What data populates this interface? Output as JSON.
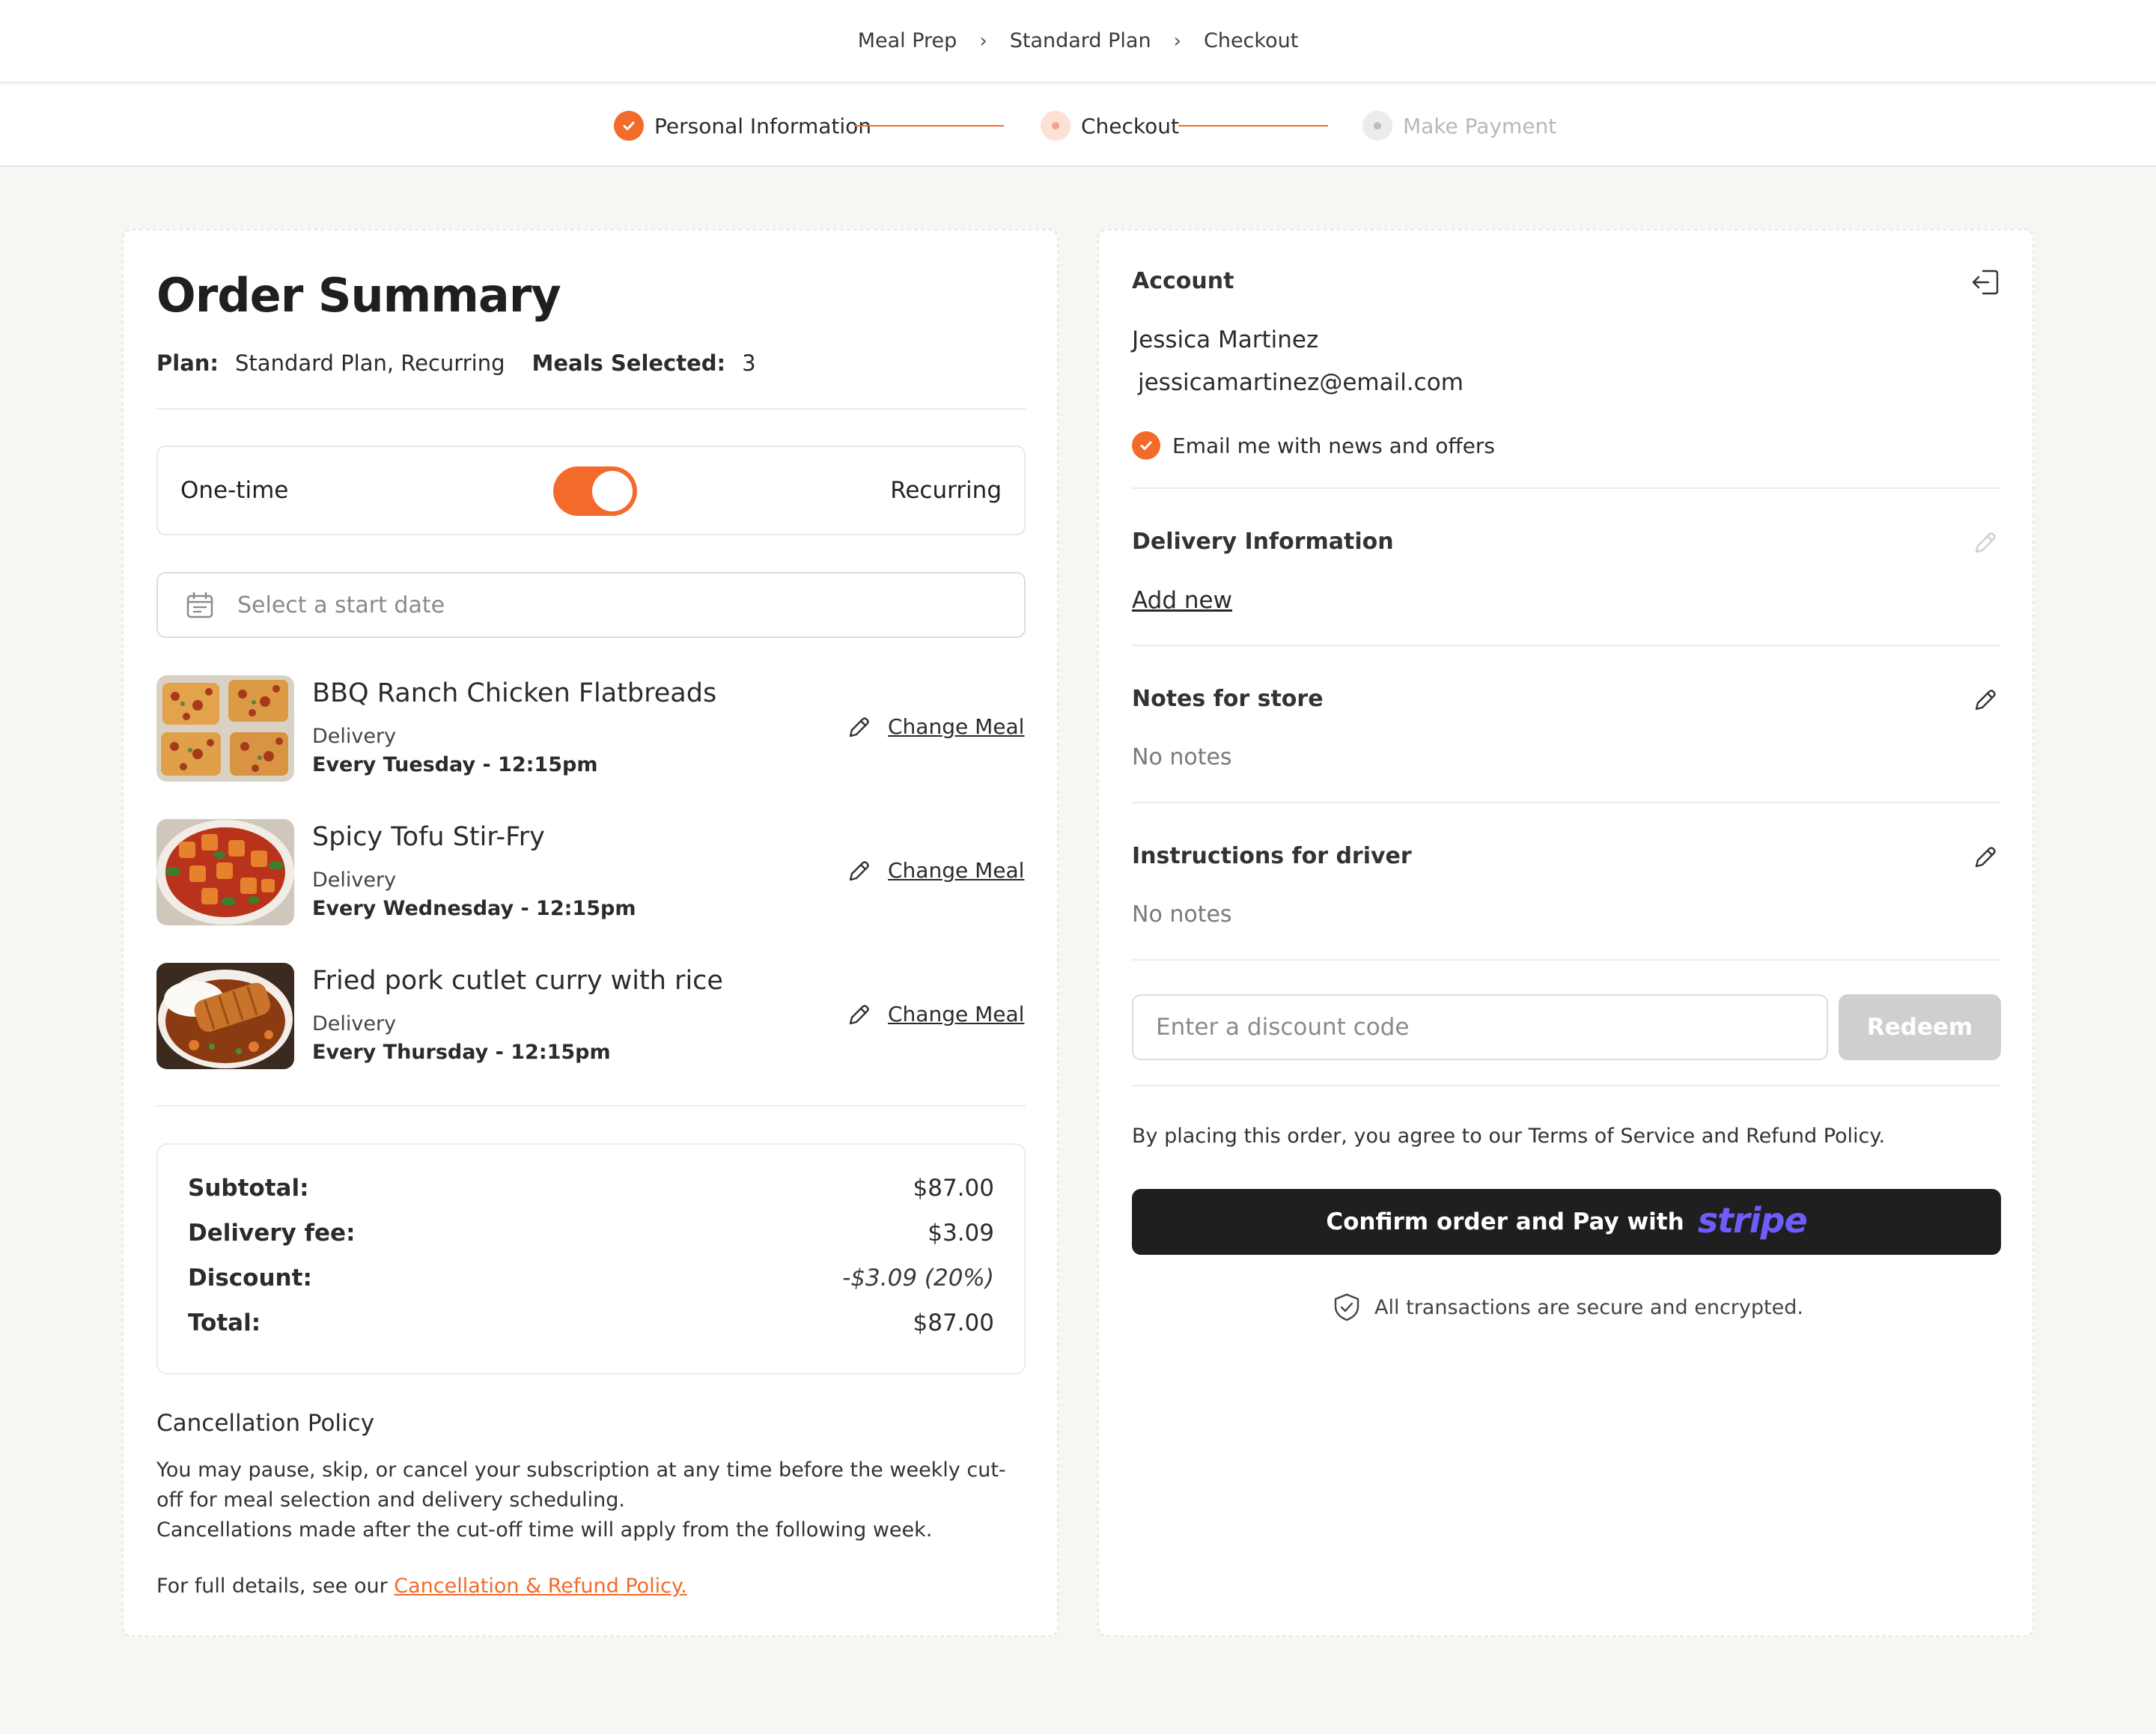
{
  "breadcrumb": [
    "Meal Prep",
    "Standard Plan",
    "Checkout"
  ],
  "breadcrumb_sep": "›",
  "steps": [
    {
      "label": "Personal Information",
      "state": "done"
    },
    {
      "label": "Checkout",
      "state": "active"
    },
    {
      "label": "Make Payment",
      "state": "pending"
    }
  ],
  "order": {
    "title": "Order Summary",
    "plan_label": "Plan:",
    "plan_value": "Standard Plan, Recurring",
    "meals_label": "Meals Selected:",
    "meals_value": "3",
    "toggle_left": "One-time",
    "toggle_right": "Recurring",
    "toggle_on": true,
    "date_placeholder": "Select a start date",
    "meals": [
      {
        "name": "BBQ Ranch Chicken Flatbreads",
        "type": "Delivery",
        "when": "Every Tuesday - 12:15pm",
        "action": "Change Meal"
      },
      {
        "name": "Spicy Tofu Stir-Fry",
        "type": "Delivery",
        "when": "Every Wednesday - 12:15pm",
        "action": "Change Meal"
      },
      {
        "name": "Fried pork cutlet curry with rice",
        "type": "Delivery",
        "when": "Every Thursday - 12:15pm",
        "action": "Change Meal"
      }
    ],
    "totals": {
      "subtotal_label": "Subtotal:",
      "subtotal": "$87.00",
      "delivery_label": "Delivery fee:",
      "delivery": "$3.09",
      "discount_label": "Discount:",
      "discount": "-$3.09 (20%)",
      "total_label": "Total:",
      "total": "$87.00"
    },
    "policy": {
      "title": "Cancellation Policy",
      "line1": "You may pause, skip, or cancel your subscription at any time before the weekly cut-off for meal selection and delivery scheduling.",
      "line2": "Cancellations made after the cut-off time will apply from the following week.",
      "full_prefix": "For full details, see our ",
      "full_link": "Cancellation & Refund Policy."
    }
  },
  "account": {
    "label": "Account",
    "name": "Jessica Martinez",
    "email": "jessicamartinez@email.com",
    "newsletter": "Email me with news and offers",
    "delivery_label": "Delivery Information",
    "add_new": "Add new",
    "notes_label": "Notes for store",
    "notes_value": "No notes",
    "driver_label": "Instructions for driver",
    "driver_value": "No notes",
    "discount_placeholder": "Enter a discount code",
    "redeem": "Redeem",
    "agree": "By placing this order, you agree to our Terms of Service and Refund Policy.",
    "pay_label": "Confirm order and Pay with",
    "pay_brand": "stripe",
    "secure": "All transactions are secure and encrypted."
  },
  "colors": {
    "accent": "#f26b2a",
    "stripe": "#6d5dfc",
    "dark_button": "#1f1f1f"
  },
  "icons": [
    "check-icon",
    "chevron-right-icon",
    "calendar-icon",
    "pencil-icon",
    "logout-icon",
    "shield-check-icon"
  ]
}
